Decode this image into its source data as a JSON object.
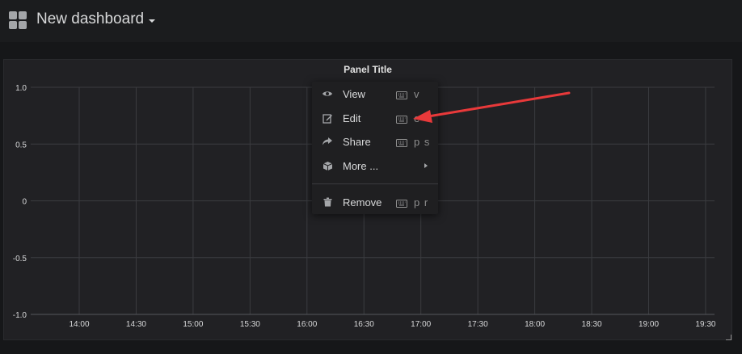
{
  "header": {
    "dashboard_title": "New dashboard",
    "icons": {
      "dashboards": "apps-grid-icon",
      "title_caret": "caret-down-icon"
    }
  },
  "panel": {
    "title": "Panel Title"
  },
  "menu": {
    "items": [
      {
        "label": "View",
        "icon": "eye-icon",
        "shortcut": "v"
      },
      {
        "label": "Edit",
        "icon": "edit-icon",
        "shortcut": "e"
      },
      {
        "label": "Share",
        "icon": "share-icon",
        "shortcut": "p s"
      },
      {
        "label": "More ...",
        "icon": "cube-icon",
        "shortcut": ""
      },
      {
        "label": "Remove",
        "icon": "trash-icon",
        "shortcut": "p r"
      }
    ],
    "keyboard_icon": "keyboard-icon",
    "submenu_icon": "caret-right-icon"
  },
  "annotation": {
    "color": "#e8393a",
    "points_to": "Edit"
  },
  "chart_data": {
    "type": "line",
    "title": "Panel Title",
    "x_ticks": [
      "14:00",
      "14:30",
      "15:00",
      "15:30",
      "16:00",
      "16:30",
      "17:00",
      "17:30",
      "18:00",
      "18:30",
      "19:00",
      "19:30"
    ],
    "y_ticks": [
      "1.0",
      "0.5",
      "0",
      "-0.5",
      "-1.0"
    ],
    "ylim": [
      -1.0,
      1.0
    ],
    "series": [],
    "grid": true,
    "legend": "none"
  },
  "colors": {
    "background": "#161719",
    "panel": "#212124",
    "grid": "#3b3c40",
    "text": "#d8d9da",
    "muted": "#8e8e8e"
  }
}
